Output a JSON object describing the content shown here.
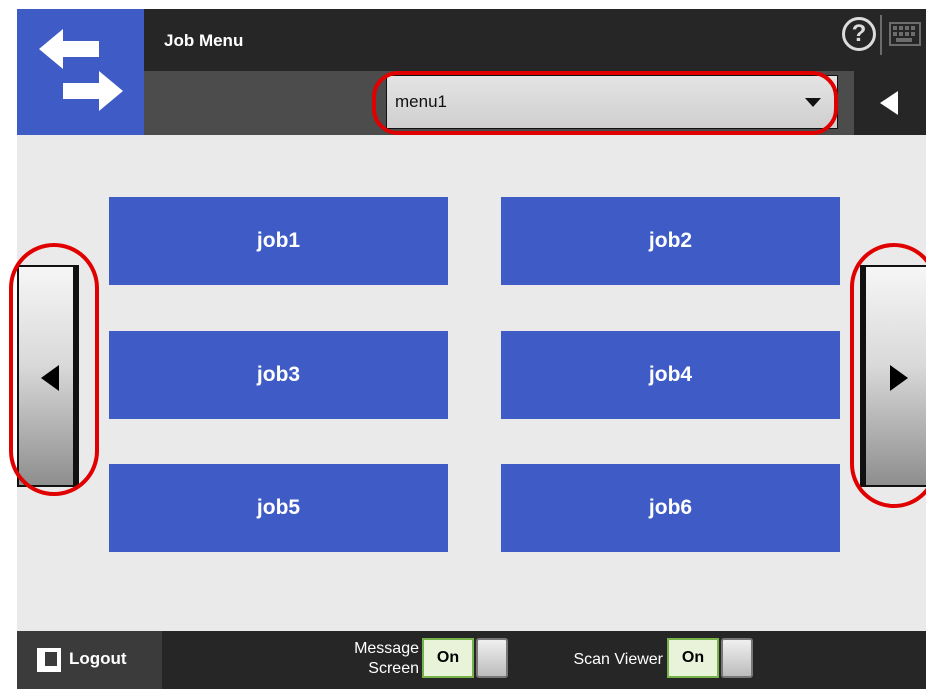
{
  "header": {
    "title": "Job Menu",
    "help_icon": "?",
    "menu_select_value": "menu1"
  },
  "icons": {
    "logo": "switch-arrows-icon",
    "help": "help-icon",
    "keyboard": "keyboard-icon",
    "back": "triangle-left-icon",
    "page_prev": "triangle-left-icon",
    "page_next": "triangle-right-icon",
    "logout": "logout-icon"
  },
  "jobs": [
    "job1",
    "job2",
    "job3",
    "job4",
    "job5",
    "job6"
  ],
  "footer": {
    "logout_label": "Logout",
    "message_screen_label_1": "Message",
    "message_screen_label_2": "Screen",
    "message_screen_state": "On",
    "scan_viewer_label": "Scan Viewer",
    "scan_viewer_state": "On"
  },
  "colors": {
    "accent_blue": "#3e5bc6",
    "header_dark": "#262626",
    "toggle_on_bg": "#e8f3d9",
    "callout_red": "#e00000"
  }
}
